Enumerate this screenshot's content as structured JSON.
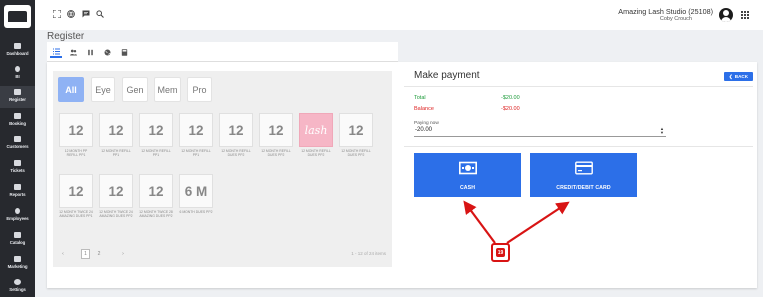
{
  "sidebar": {
    "items": [
      {
        "label": "Dashboard",
        "icon": "dashboard-icon"
      },
      {
        "label": "BI",
        "icon": "bulb-icon"
      },
      {
        "label": "Register",
        "icon": "cart-icon",
        "active": true
      },
      {
        "label": "Booking",
        "icon": "calendar-icon"
      },
      {
        "label": "Customers",
        "icon": "people-icon"
      },
      {
        "label": "Tickets",
        "icon": "ticket-icon"
      },
      {
        "label": "Reports",
        "icon": "bar-chart-icon"
      },
      {
        "label": "Employees",
        "icon": "person-icon"
      },
      {
        "label": "Catalog",
        "icon": "list-icon"
      },
      {
        "label": "Marketing",
        "icon": "tag-icon"
      },
      {
        "label": "Settings",
        "icon": "gear-icon"
      }
    ]
  },
  "header": {
    "studio": "Amazing Lash Studio (25108)",
    "user": "Coby Crouch",
    "icons": [
      "fullscreen-icon",
      "globe-icon",
      "chat-icon",
      "search-icon",
      "apps-grid-icon"
    ]
  },
  "page": {
    "title": "Register"
  },
  "tabs": [
    "list-view-icon",
    "customers-icon",
    "pause-icon",
    "globe-icon",
    "calculator-icon"
  ],
  "categories": [
    "All",
    "Eye",
    "Gen",
    "Mem",
    "Pro"
  ],
  "products": [
    {
      "badge": "12",
      "name": "12 MONTH PP REFILL PP1"
    },
    {
      "badge": "12",
      "name": "12 MONTH REFILL PP1"
    },
    {
      "badge": "12",
      "name": "12 MONTH REFILL PP1"
    },
    {
      "badge": "12",
      "name": "12 MONTH REFILL PP1"
    },
    {
      "badge": "12",
      "name": "12 MONTH REFILL DUES PP2"
    },
    {
      "badge": "12",
      "name": "12 MONTH REFILL DUES PP2"
    },
    {
      "badge": "lash",
      "name": "12 MONTH REFILL DUES PP2",
      "image": true
    },
    {
      "badge": "12",
      "name": "12 MONTH REFILL DUES PP2"
    },
    {
      "badge": "12",
      "name": "12 MONTH TWICE 24 AMAZING DUES PP1"
    },
    {
      "badge": "12",
      "name": "12 MONTH TWICE 24 AMAZING DUES PP2"
    },
    {
      "badge": "12",
      "name": "12 MONTH TWICE 28 AMAZING DUES PP2"
    },
    {
      "badge": "6 M",
      "name": "6 MONTH DUES PP2"
    }
  ],
  "pager": {
    "prev": "‹",
    "pages": [
      "1",
      "2"
    ],
    "next": "›",
    "info": "1 - 12 of 24 items"
  },
  "payment": {
    "title": "Make payment",
    "back": "BACK",
    "total_label": "Total",
    "total_value": "-$20.00",
    "balance_label": "Balance",
    "balance_value": "-$20.00",
    "paying_label": "Paying now",
    "paying_value": "-20.00",
    "cash_label": "CASH",
    "card_label": "CREDIT/DEBIT CARD"
  },
  "annotation": {
    "marker": "19"
  },
  "colors": {
    "accent": "#2c6fe8",
    "sidebar": "#27292e",
    "total": "#1d9b3a",
    "balance": "#dd2222",
    "annotation": "#d81414"
  }
}
